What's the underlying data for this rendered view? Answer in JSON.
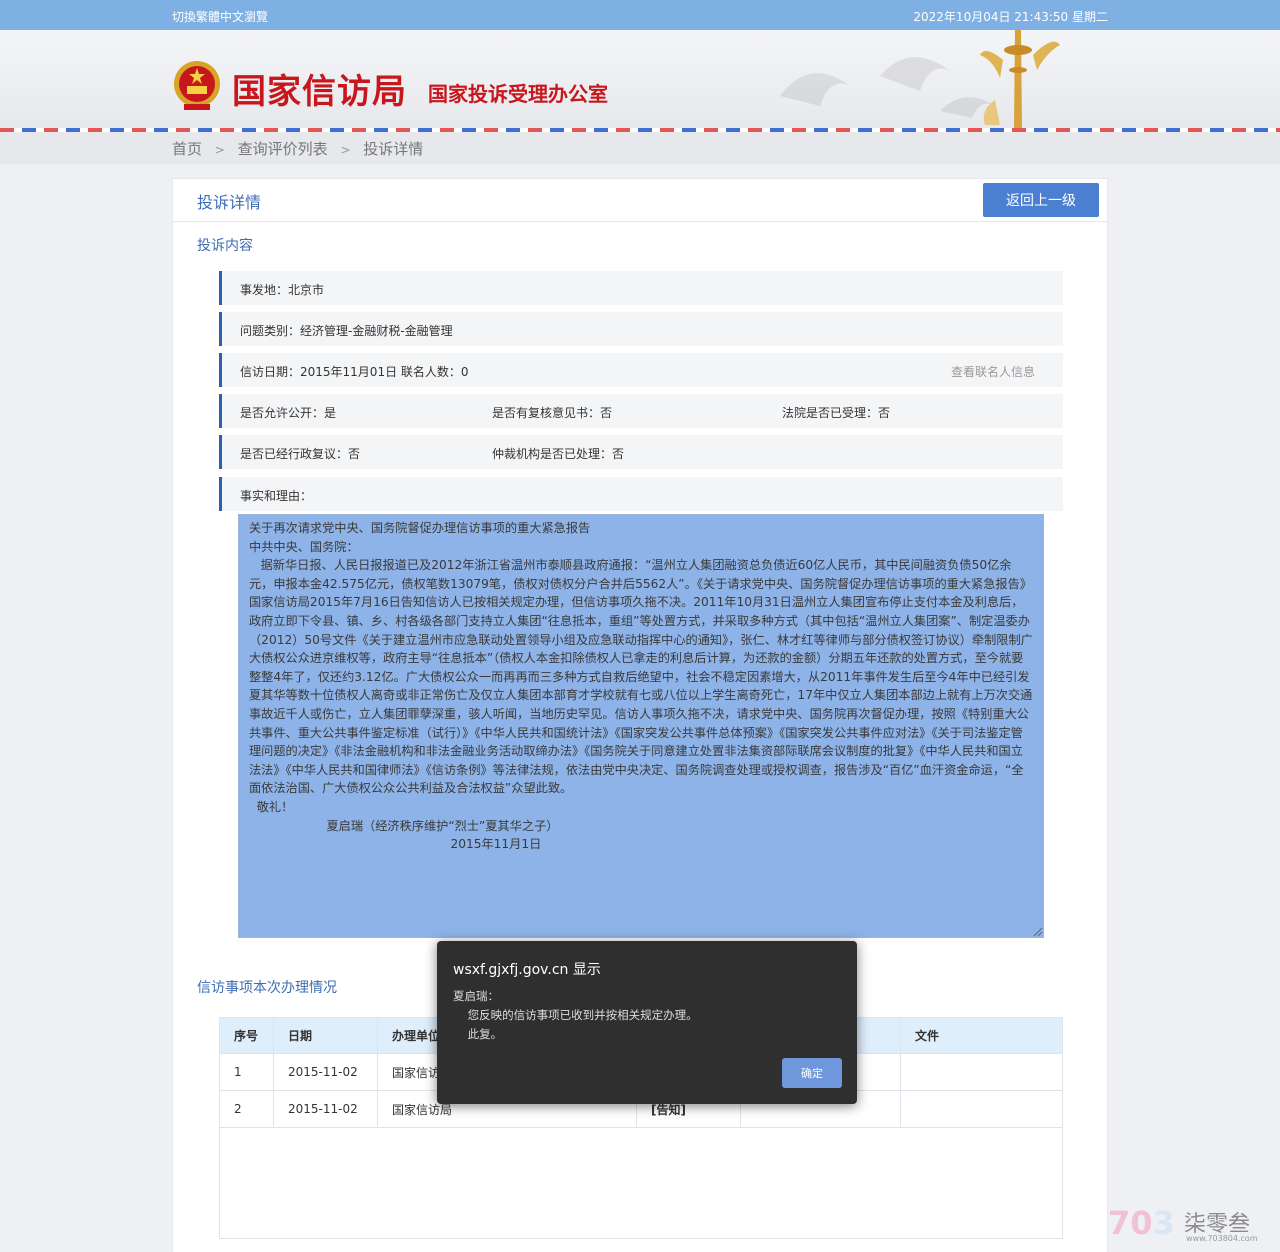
{
  "topbar": {
    "lang_switch": "切換繁體中文瀏覽",
    "datetime": "2022年10月04日 21:43:50 星期二"
  },
  "header": {
    "title": "国家信访局",
    "subtitle": "国家投诉受理办公室"
  },
  "breadcrumb": {
    "home": "首页",
    "list": "查询评价列表",
    "current": "投诉详情",
    "separator": ">"
  },
  "panel": {
    "title": "投诉详情",
    "back_label": "返回上一级",
    "section_content": "投诉内容",
    "section_records": "信访事项本次办理情况"
  },
  "details": {
    "location": "事发地：北京市",
    "category": "问题类别：经济管理-金融财税-金融管理",
    "date_and_joint": "信访日期：2015年11月01日 联名人数：0",
    "view_joint_link": "查看联名人信息",
    "allow_public": "是否允许公开：是",
    "has_review_opinion": "是否有复核意见书：否",
    "court_accepted": "法院是否已受理：否",
    "admin_review": "是否已经行政复议：否",
    "arbitration": "仲裁机构是否已处理：否",
    "facts_label": "事实和理由："
  },
  "facts_text": "关于再次请求党中央、国务院督促办理信访事项的重大紧急报告\n中共中央、国务院：\n   据新华日报、人民日报报道已及2012年浙江省温州市泰顺县政府通报：“温州立人集团融资总负债近60亿人民币，其中民间融资负债50亿余元，申报本金42.575亿元，债权笔数13079笔，债权对债权分户合并后5562人”。《关于请求党中央、国务院督促办理信访事项的重大紧急报告》国家信访局2015年7月16日告知信访人已按相关规定办理，但信访事项久拖不决。2011年10月31日温州立人集团宣布停止支付本金及利息后，政府立即下令县、镇、乡、村各级各部门支持立人集团“往息抵本，重组”等处置方式，并采取多种方式（其中包括“温州立人集团案”、制定温委办（2012）50号文件《关于建立温州市应急联动处置领导小组及应急联动指挥中心的通知》，张仁、林才红等律师与部分债权签订协议）牵制限制广大债权公众进京维权等，政府主导“往息抵本”（债权人本金扣除债权人已拿走的利息后计算，为还款的金额）分期五年还款的处置方式，至今就要整整4年了，仅还约3.12亿。广大债权公众一而再再而三多种方式自救后绝望中，社会不稳定因素增大，从2011年事件发生后至今4年中已经引发夏其华等数十位债权人离奇或非正常伤亡及仅立人集团本部育才学校就有七或八位以上学生离奇死亡，17年中仅立人集团本部边上就有上万次交通事故近千人或伤亡，立人集团罪孽深重，骇人听闻，当地历史罕见。信访人事项久拖不决，请求党中央、国务院再次督促办理，按照《特别重大公共事件、重大公共事件鉴定标准（试行）》《中华人民共和国统计法》《国家突发公共事件总体预案》《国家突发公共事件应对法》《关于司法鉴定管理问题的决定》《非法金融机构和非法金融业务活动取缔办法》《国务院关于同意建立处置非法集资部际联席会议制度的批复》《中华人民共和国立法法》《中华人民共和国律师法》《信访条例》等法律法规，依法由党中央决定、国务院调查处理或授权调查，报告涉及“百亿”血汗资金命运，“全面依法治国、广大债权公众公共利益及合法权益”众望此致。\n  敬礼！\n                    夏启瑞（经济秩序维护“烈士”夏其华之子）\n                                                    2015年11月1日",
  "records": {
    "headers": [
      "序号",
      "日期",
      "办理单位",
      "",
      "",
      "文件"
    ],
    "rows": [
      {
        "no": "1",
        "date": "2015-11-02",
        "unit": "国家信访局",
        "status": "",
        "extra": "",
        "file": ""
      },
      {
        "no": "2",
        "date": "2015-11-02",
        "unit": "国家信访局",
        "status": "[告知]",
        "extra": "",
        "file": ""
      }
    ]
  },
  "dialog": {
    "title": "wsxf.gjxfj.gov.cn 显示",
    "message": "夏启瑞：\n    您反映的信访事项已收到并按相关规定办理。\n    此复。",
    "ok_label": "确定"
  },
  "watermark": {
    "number_prefix": "70",
    "number_suffix": "3",
    "brand": "柒零叁",
    "url": "www.703804.com"
  },
  "colors": {
    "topbar": "#7fb0e3",
    "brand_red": "#c8161d",
    "accent_blue": "#4a7fd1",
    "row_border": "#2f5fb0",
    "textarea_selection": "#8db3e8"
  },
  "icons": [
    "national-emblem-icon",
    "tower-icon",
    "resize-grip-icon"
  ]
}
